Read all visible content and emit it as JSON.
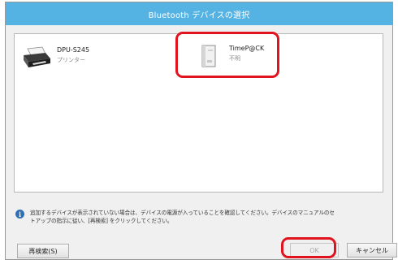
{
  "dialog": {
    "title": "Bluetooth デバイスの選択"
  },
  "devices": [
    {
      "name": "DPU-S245",
      "status": "プリンター",
      "icon": "printer-icon"
    },
    {
      "name": "TimeP@CK",
      "status": "不明",
      "icon": "device-unknown-icon"
    }
  ],
  "info": {
    "icon": "info-icon",
    "line1": "追加するデバイスが表示されていない場合は、デバイスの電源が入っていることを確認してください。デバイスのマニュアルのセ",
    "line2": "トアップの指示に従い、[再検索] をクリックしてください。"
  },
  "buttons": {
    "research": "再検索(S)",
    "ok": "OK",
    "cancel": "キャンセル"
  },
  "colors": {
    "titlebar": "#55b3e3",
    "highlight": "#e0141e",
    "info_icon": "#2f6fb6"
  }
}
